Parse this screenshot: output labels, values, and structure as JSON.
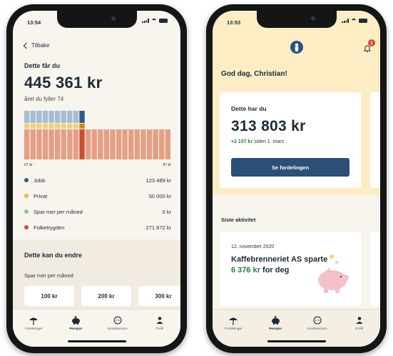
{
  "left": {
    "status_time": "13:54",
    "back_label": "Tilbake",
    "title": "Dette får du",
    "amount": "445 361 kr",
    "subtitle": "året du fyller 74",
    "axis_start": "67 år",
    "axis_end": "87 år",
    "legend": [
      {
        "label": "Jobb",
        "value": "123 489 kr",
        "color": "#2f5d8a"
      },
      {
        "label": "Privat",
        "value": "50 000 kr",
        "color": "#f0b83a"
      },
      {
        "label": "Spar mer per måned",
        "value": "0 kr",
        "color": "#7cc9a0"
      },
      {
        "label": "Folketrygden",
        "value": "271 872 kr",
        "color": "#c94f30"
      }
    ],
    "section_title": "Dette kan du endre",
    "spar_label": "Spar mer per måned",
    "chips": [
      "100 kr",
      "200 kr",
      "300 kr"
    ]
  },
  "right": {
    "status_time": "13:53",
    "notification_count": "1",
    "greeting": "God dag, Christian!",
    "card_title": "Dette har du",
    "amount": "313 803 kr",
    "delta_value": "+2 157 kr",
    "delta_text": "siden 1. mars",
    "button_label": "Se fordelingen",
    "activity_title": "Siste aktivitet",
    "activity_date": "12. november 2020",
    "activity_line": "Kaffebrenneriet AS sparte",
    "activity_amount": "6 376 kr",
    "activity_suffix": "for deg"
  },
  "tabs": [
    {
      "label": "Forsikringer",
      "icon": "umbrella-icon"
    },
    {
      "label": "Pensjon",
      "icon": "piggy-bank-icon"
    },
    {
      "label": "Kundeservice",
      "icon": "chat-icon"
    },
    {
      "label": "Profil",
      "icon": "person-icon"
    }
  ],
  "active_tab": "Pensjon",
  "colors": {
    "dark_blue": "#2b4f75",
    "header_yellow": "#fcedc4",
    "green": "#2a7a4b",
    "bar_top": "#a8bdd2",
    "bar_mid": "#f2cf86",
    "bar_base": "#e49f84",
    "bar_highlight": "#c94f30"
  }
}
